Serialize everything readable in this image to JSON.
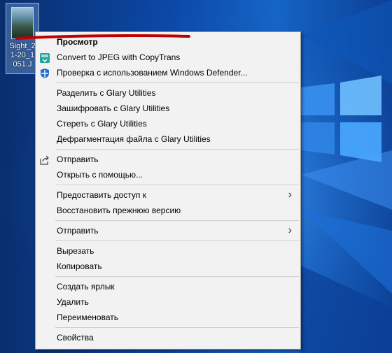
{
  "desktop": {
    "file_label": "Sight_2\n1-20_1\n051.J"
  },
  "menu": {
    "items": [
      {
        "label": "Просмотр",
        "bold": true
      },
      {
        "label": "Convert to JPEG with CopyTrans",
        "icon": "copytrans-icon"
      },
      {
        "label": "Проверка с использованием Windows Defender...",
        "icon": "windows-defender-icon"
      },
      {
        "separator": true
      },
      {
        "label": "Разделить с Glary Utilities"
      },
      {
        "label": "Зашифровать с Glary Utilities"
      },
      {
        "label": "Стереть с Glary Utilities"
      },
      {
        "label": "Дефрагментация файла с Glary Utilities"
      },
      {
        "separator": true
      },
      {
        "label": "Отправить",
        "icon": "share-icon"
      },
      {
        "label": "Открыть с помощью..."
      },
      {
        "separator": true
      },
      {
        "label": "Предоставить доступ к",
        "submenu": true
      },
      {
        "label": "Восстановить прежнюю версию"
      },
      {
        "separator": true
      },
      {
        "label": "Отправить",
        "submenu": true
      },
      {
        "separator": true
      },
      {
        "label": "Вырезать"
      },
      {
        "label": "Копировать"
      },
      {
        "separator": true
      },
      {
        "label": "Создать ярлык"
      },
      {
        "label": "Удалить"
      },
      {
        "label": "Переименовать"
      },
      {
        "separator": true
      },
      {
        "label": "Свойства"
      }
    ]
  },
  "colors": {
    "menu_bg": "#f2f2f2",
    "annotation_red": "#c00000"
  }
}
